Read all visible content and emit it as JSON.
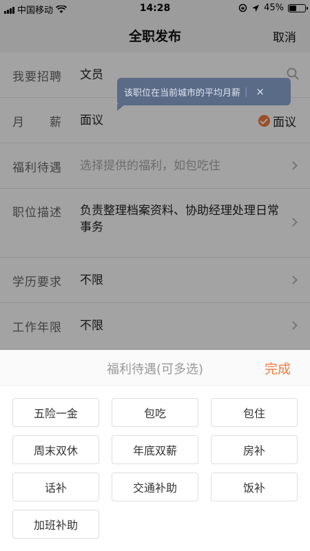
{
  "status": {
    "carrier": "中国移动",
    "time": "14:28",
    "battery_text": "45%",
    "battery_level": 0.45
  },
  "nav": {
    "title": "全职发布",
    "cancel_label": "取消"
  },
  "form": {
    "position": {
      "label": "我要招聘",
      "value": "文员"
    },
    "salary": {
      "label": "月　　薪",
      "value": "面议",
      "check_label": "面议"
    },
    "welfare": {
      "label": "福利待遇",
      "placeholder": "选择提供的福利，如包吃住"
    },
    "description": {
      "label": "职位描述",
      "value": "负责整理档案资料、协助经理处理日常事务"
    },
    "education": {
      "label": "学历要求",
      "value": "不限"
    },
    "experience": {
      "label": "工作年限",
      "value": "不限"
    }
  },
  "tooltip": {
    "text": "该职位在当前城市的平均月薪",
    "separator": "|",
    "close": "×"
  },
  "sheet": {
    "title": "福利待遇(可多选)",
    "done_label": "完成",
    "options": [
      "五险一金",
      "包吃",
      "包住",
      "周末双休",
      "年底双薪",
      "房补",
      "话补",
      "交通补助",
      "饭补",
      "加班补助"
    ]
  },
  "colors": {
    "accent": "#f47b3c",
    "tooltip_bg": "#5a6b88"
  }
}
